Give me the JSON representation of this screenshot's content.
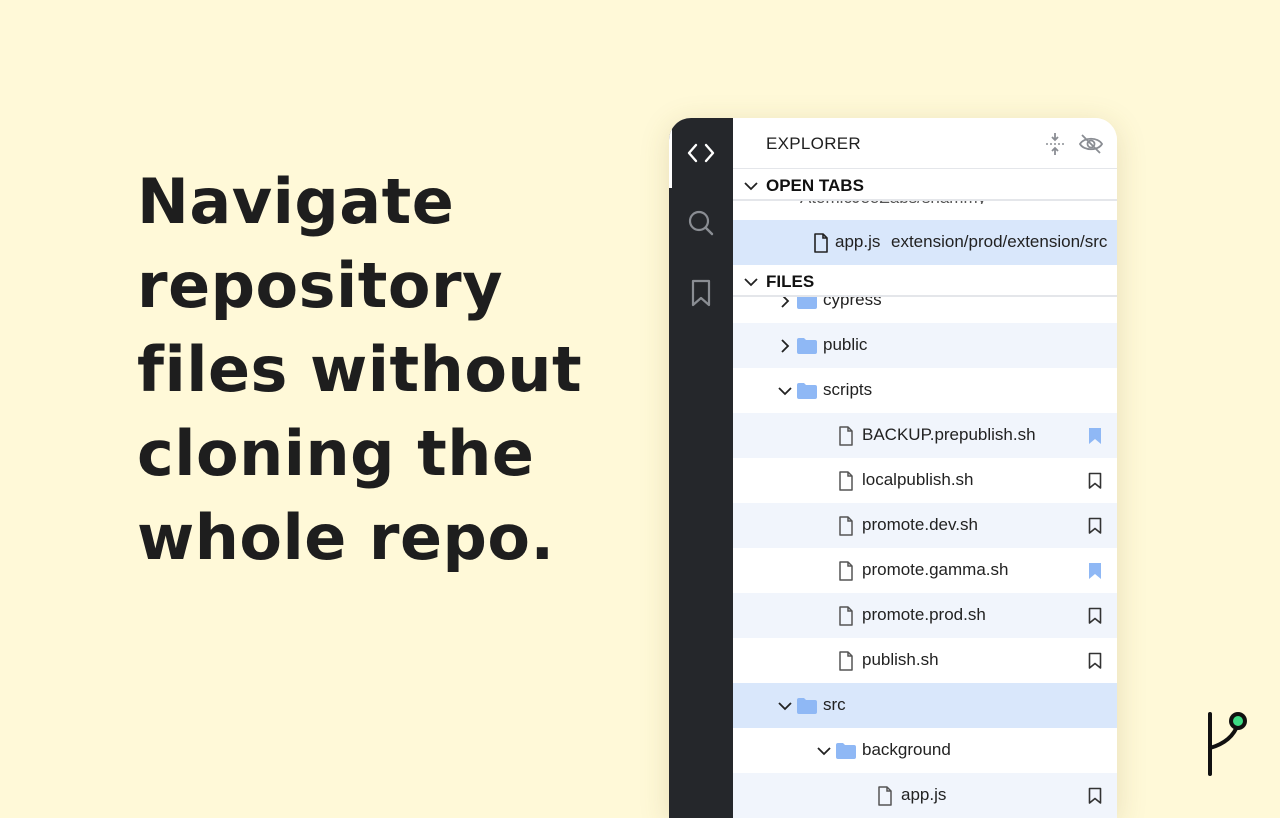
{
  "headline": {
    "lines": [
      "Navigate",
      "repository",
      "files without",
      "cloning the",
      "whole repo."
    ]
  },
  "explorer": {
    "title": "EXPLORER",
    "open_tabs_label": "OPEN TABS",
    "partial_repo": "AtomicJeoZabs/shammy",
    "open_tab": {
      "name": "app.js",
      "path": "extension/prod/extension/src"
    },
    "files_label": "FILES",
    "tree": [
      {
        "name": "cypress",
        "type": "folder",
        "expanded": false
      },
      {
        "name": "public",
        "type": "folder",
        "expanded": false
      },
      {
        "name": "scripts",
        "type": "folder",
        "expanded": true
      },
      {
        "name": "BACKUP.prepublish.sh",
        "type": "file",
        "bookmarked": true
      },
      {
        "name": "localpublish.sh",
        "type": "file",
        "bookmarked": false
      },
      {
        "name": "promote.dev.sh",
        "type": "file",
        "bookmarked": false
      },
      {
        "name": "promote.gamma.sh",
        "type": "file",
        "bookmarked": true
      },
      {
        "name": "promote.prod.sh",
        "type": "file",
        "bookmarked": false
      },
      {
        "name": "publish.sh",
        "type": "file",
        "bookmarked": false
      },
      {
        "name": "src",
        "type": "folder",
        "expanded": true
      },
      {
        "name": "background",
        "type": "folder",
        "expanded": true
      },
      {
        "name": "app.js",
        "type": "file",
        "bookmarked": false
      }
    ]
  },
  "colors": {
    "background": "#fff9d8",
    "activity_bar": "#25272b",
    "folder": "#8fb8f5",
    "bookmark_active": "#8fb8f5",
    "selection": "#d9e7fb",
    "logo_accent": "#3ddc84"
  }
}
